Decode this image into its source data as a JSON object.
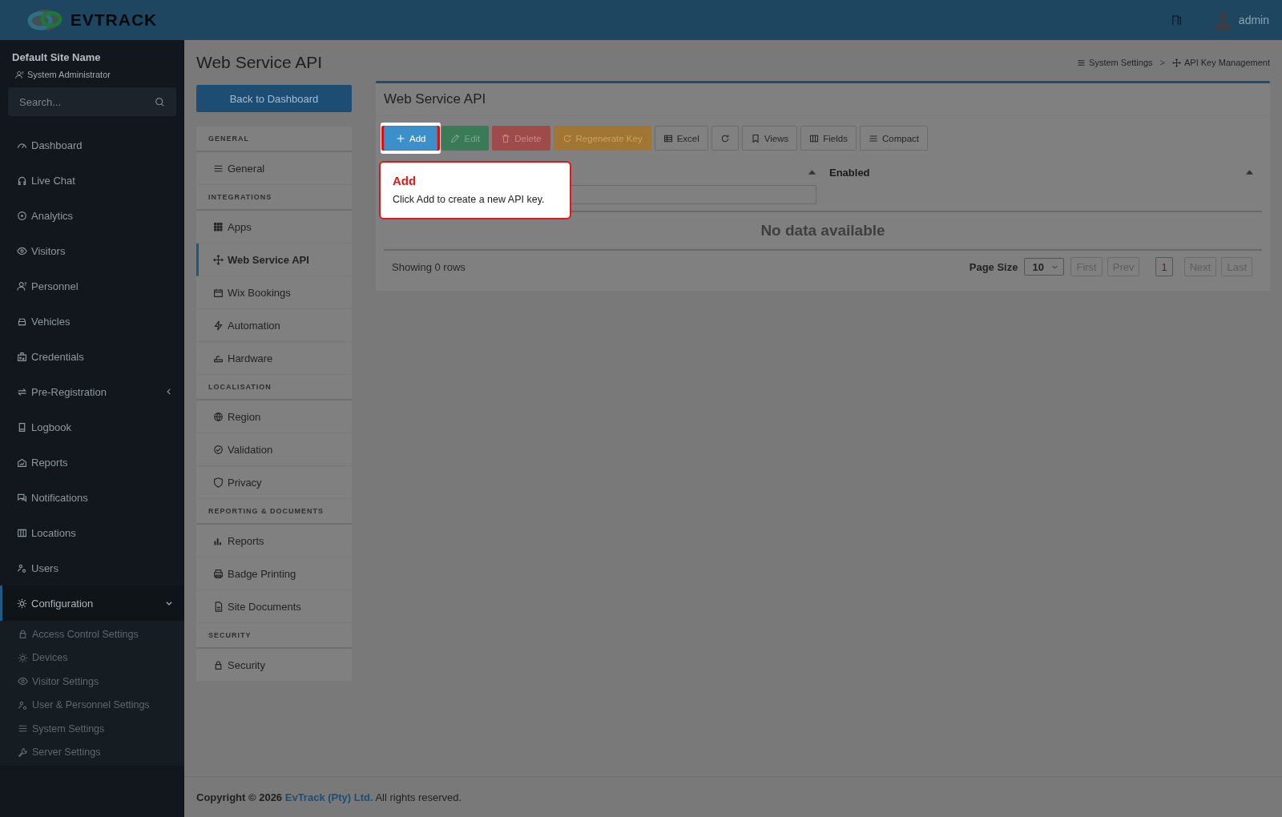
{
  "header": {
    "logo_text": "EVTRACK",
    "user": "admin"
  },
  "sidebar": {
    "site_name": "Default Site Name",
    "role": "System Administrator",
    "search": {
      "placeholder": "Search..."
    },
    "items": [
      {
        "label": "Dashboard",
        "kind": "link",
        "selected": false
      },
      {
        "label": "Live Chat",
        "kind": "link",
        "selected": false
      },
      {
        "label": "Analytics",
        "kind": "link",
        "selected": false
      },
      {
        "label": "Visitors",
        "kind": "link",
        "selected": false
      },
      {
        "label": "Personnel",
        "kind": "link",
        "selected": false
      },
      {
        "label": "Vehicles",
        "kind": "link",
        "selected": false
      },
      {
        "label": "Credentials",
        "kind": "link",
        "selected": false
      },
      {
        "label": "Pre-Registration",
        "kind": "group",
        "selected": false,
        "expanded": false
      },
      {
        "label": "Logbook",
        "kind": "link",
        "selected": false
      },
      {
        "label": "Reports",
        "kind": "link",
        "selected": false
      },
      {
        "label": "Notifications",
        "kind": "link",
        "selected": false
      },
      {
        "label": "Locations",
        "kind": "link",
        "selected": false
      },
      {
        "label": "Users",
        "kind": "link",
        "selected": false
      },
      {
        "label": "Configuration",
        "kind": "group",
        "selected": true,
        "expanded": true,
        "children": [
          {
            "label": "Access Control Settings",
            "selected": false
          },
          {
            "label": "Devices",
            "selected": false
          },
          {
            "label": "Visitor Settings",
            "selected": false
          },
          {
            "label": "User & Personnel Settings",
            "selected": false
          },
          {
            "label": "System Settings",
            "selected": false
          },
          {
            "label": "Server Settings",
            "selected": false
          }
        ]
      }
    ]
  },
  "page": {
    "title": "Web Service API",
    "back_button": "Back to Dashboard",
    "breadcrumb": [
      {
        "label": "System Settings"
      },
      {
        "label": "API Key Management"
      }
    ],
    "breadcrumb_separator": ">"
  },
  "settings_nav": [
    {
      "heading": "GENERAL",
      "items": [
        {
          "label": "General",
          "selected": false
        }
      ]
    },
    {
      "heading": "INTEGRATIONS",
      "items": [
        {
          "label": "Apps",
          "selected": false
        },
        {
          "label": "Web Service API",
          "selected": true
        },
        {
          "label": "Wix Bookings",
          "selected": false
        },
        {
          "label": "Automation",
          "selected": false
        },
        {
          "label": "Hardware",
          "selected": false
        }
      ]
    },
    {
      "heading": "LOCALISATION",
      "items": [
        {
          "label": "Region",
          "selected": false
        },
        {
          "label": "Validation",
          "selected": false
        },
        {
          "label": "Privacy",
          "selected": false
        }
      ]
    },
    {
      "heading": "REPORTING & DOCUMENTS",
      "items": [
        {
          "label": "Reports",
          "selected": false
        },
        {
          "label": "Badge Printing",
          "selected": false
        },
        {
          "label": "Site Documents",
          "selected": false
        }
      ]
    },
    {
      "heading": "SECURITY",
      "items": [
        {
          "label": "Security",
          "selected": false
        }
      ]
    }
  ],
  "card": {
    "title": "Web Service API",
    "toolbar": [
      {
        "label": "Add",
        "kind": "primary",
        "disabled": false,
        "highlighted": true
      },
      {
        "label": "Edit",
        "kind": "success",
        "disabled": true,
        "highlighted": false
      },
      {
        "label": "Delete",
        "kind": "danger",
        "disabled": true,
        "highlighted": false
      },
      {
        "label": "Regenerate Key",
        "kind": "warning",
        "disabled": true,
        "highlighted": false
      },
      {
        "label": "Excel",
        "kind": "default",
        "disabled": false,
        "highlighted": false
      },
      {
        "kind": "default",
        "disabled": false,
        "highlighted": false
      },
      {
        "label": "Views",
        "kind": "default",
        "disabled": false,
        "highlighted": false
      },
      {
        "label": "Fields",
        "kind": "default",
        "disabled": false,
        "highlighted": false
      },
      {
        "label": "Compact",
        "kind": "default",
        "disabled": false,
        "highlighted": false
      }
    ],
    "columns": [
      {
        "filter": true
      },
      {
        "label": "Enabled",
        "filter": false
      }
    ],
    "empty_message": "No data available",
    "row_count": "Showing 0 rows",
    "page_size_label": "Page Size",
    "page_size": "10",
    "pager": [
      {
        "label": "First",
        "kind": "nav",
        "disabled": true
      },
      {
        "label": "Prev",
        "kind": "nav",
        "disabled": true
      },
      {
        "label": "1",
        "kind": "page",
        "selected": true
      },
      {
        "label": "Next",
        "kind": "nav",
        "disabled": true
      },
      {
        "label": "Last",
        "kind": "nav",
        "disabled": true
      }
    ]
  },
  "tooltip": {
    "title": "Add",
    "text": "Click Add to create a new API key."
  },
  "footer": {
    "prefix": "Copyright © 2026",
    "link": "EvTrack (Pty) Ltd.",
    "suffix": "All rights reserved."
  }
}
